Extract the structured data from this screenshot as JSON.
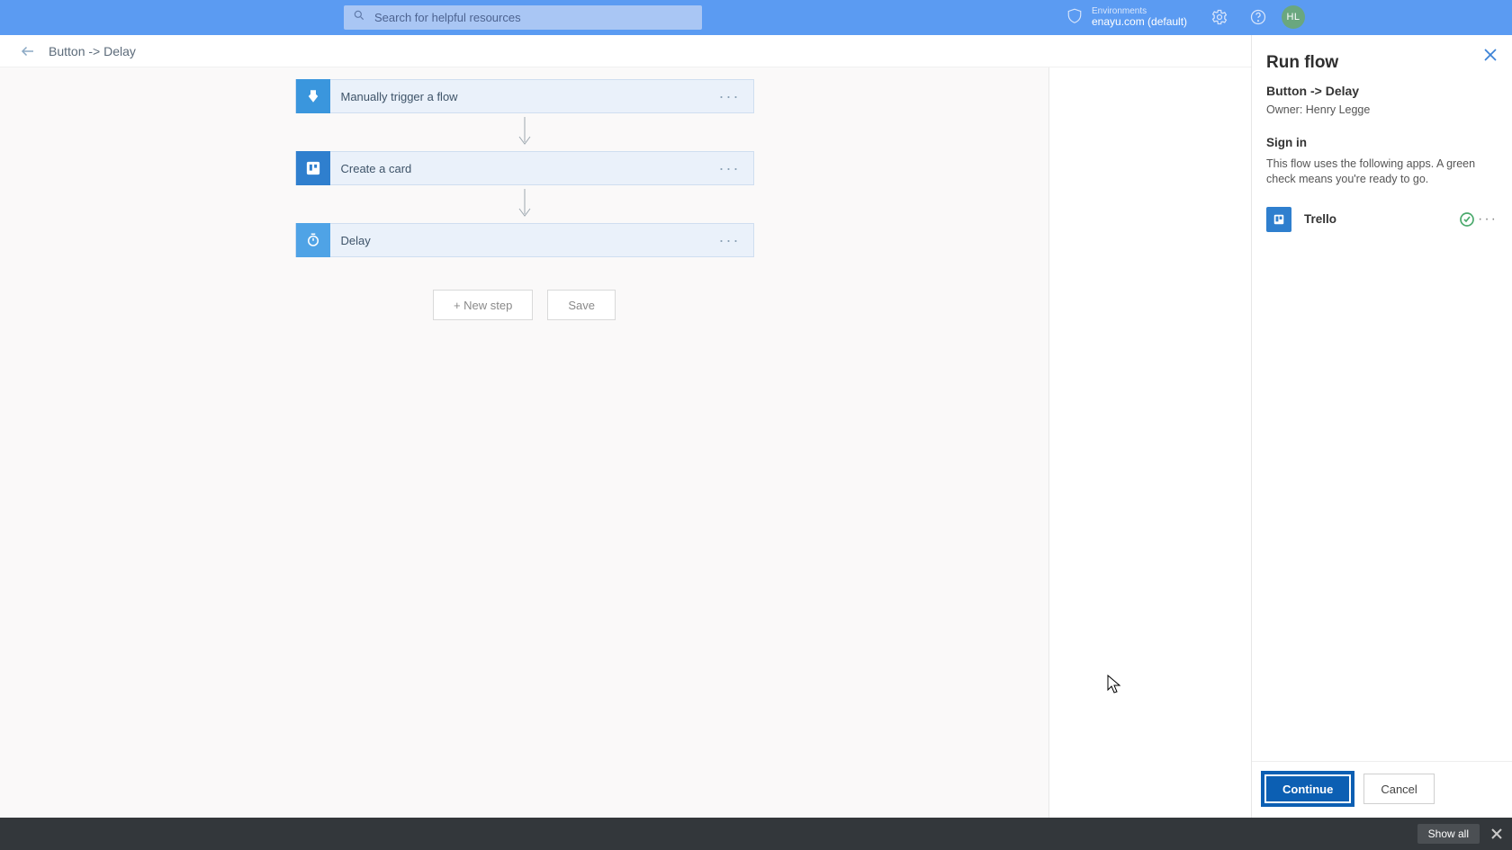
{
  "header": {
    "search_placeholder": "Search for helpful resources",
    "env_label": "Environments",
    "env_name": "enayu.com (default)",
    "avatar_initials": "HL"
  },
  "breadcrumb": {
    "title": "Button -> Delay"
  },
  "steps": {
    "s1": "Manually trigger a flow",
    "s2": "Create a card",
    "s3": "Delay"
  },
  "actions": {
    "new_step": "+ New step",
    "save": "Save"
  },
  "panel": {
    "title": "Run flow",
    "flow_name": "Button -> Delay",
    "owner": "Owner: Henry Legge",
    "signin_heading": "Sign in",
    "signin_desc": "This flow uses the following apps. A green check means you're ready to go.",
    "connection_name": "Trello",
    "continue": "Continue",
    "cancel": "Cancel"
  },
  "notif": {
    "show_all": "Show all"
  }
}
